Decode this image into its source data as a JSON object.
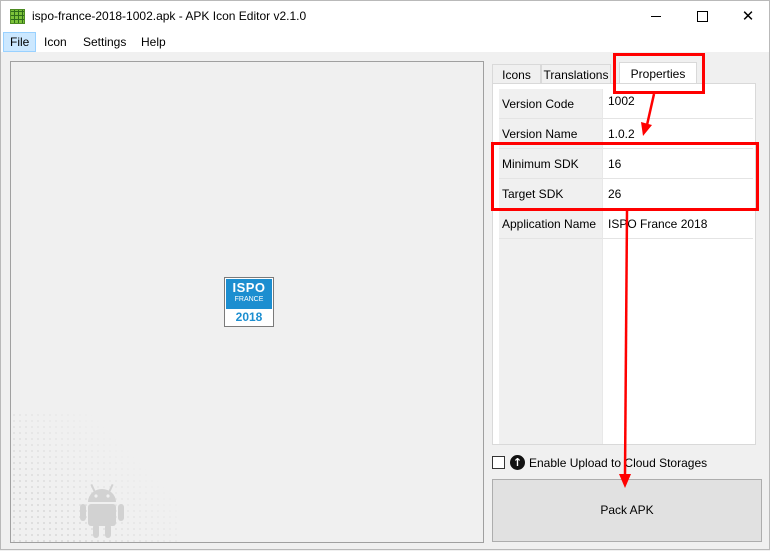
{
  "window": {
    "title": "ispo-france-2018-1002.apk - APK Icon Editor v2.1.0",
    "app_icon": "grid-app-icon",
    "controls": [
      "minimize-icon",
      "maximize-icon",
      "close-icon"
    ],
    "close_glyph": "✕"
  },
  "menu": {
    "items": [
      {
        "label": "File"
      },
      {
        "label": "Icon"
      },
      {
        "label": "Settings"
      },
      {
        "label": "Help"
      }
    ]
  },
  "preview": {
    "icon": {
      "brand": "ISPO",
      "subtitle": "FRANCE",
      "year": "2018",
      "color": "#1c8ed0"
    },
    "watermark": "android-robot-icon"
  },
  "tabs": [
    {
      "label": "Icons",
      "active": false
    },
    {
      "label": "Translations",
      "active": false
    },
    {
      "label": "Properties",
      "active": true
    }
  ],
  "properties": [
    {
      "label": "Version Code",
      "value": "1002"
    },
    {
      "label": "Version Name",
      "value": "1.0.2"
    },
    {
      "label": "Minimum SDK",
      "value": "16"
    },
    {
      "label": "Target SDK",
      "value": "26"
    },
    {
      "label": "Application Name",
      "value": "ISPO France 2018"
    }
  ],
  "upload": {
    "checked": false,
    "icon": "upload-arrow-icon",
    "label": "Enable Upload to Cloud Storages"
  },
  "pack_button": {
    "label": "Pack APK"
  },
  "annotations": {
    "color": "#ff0000"
  }
}
